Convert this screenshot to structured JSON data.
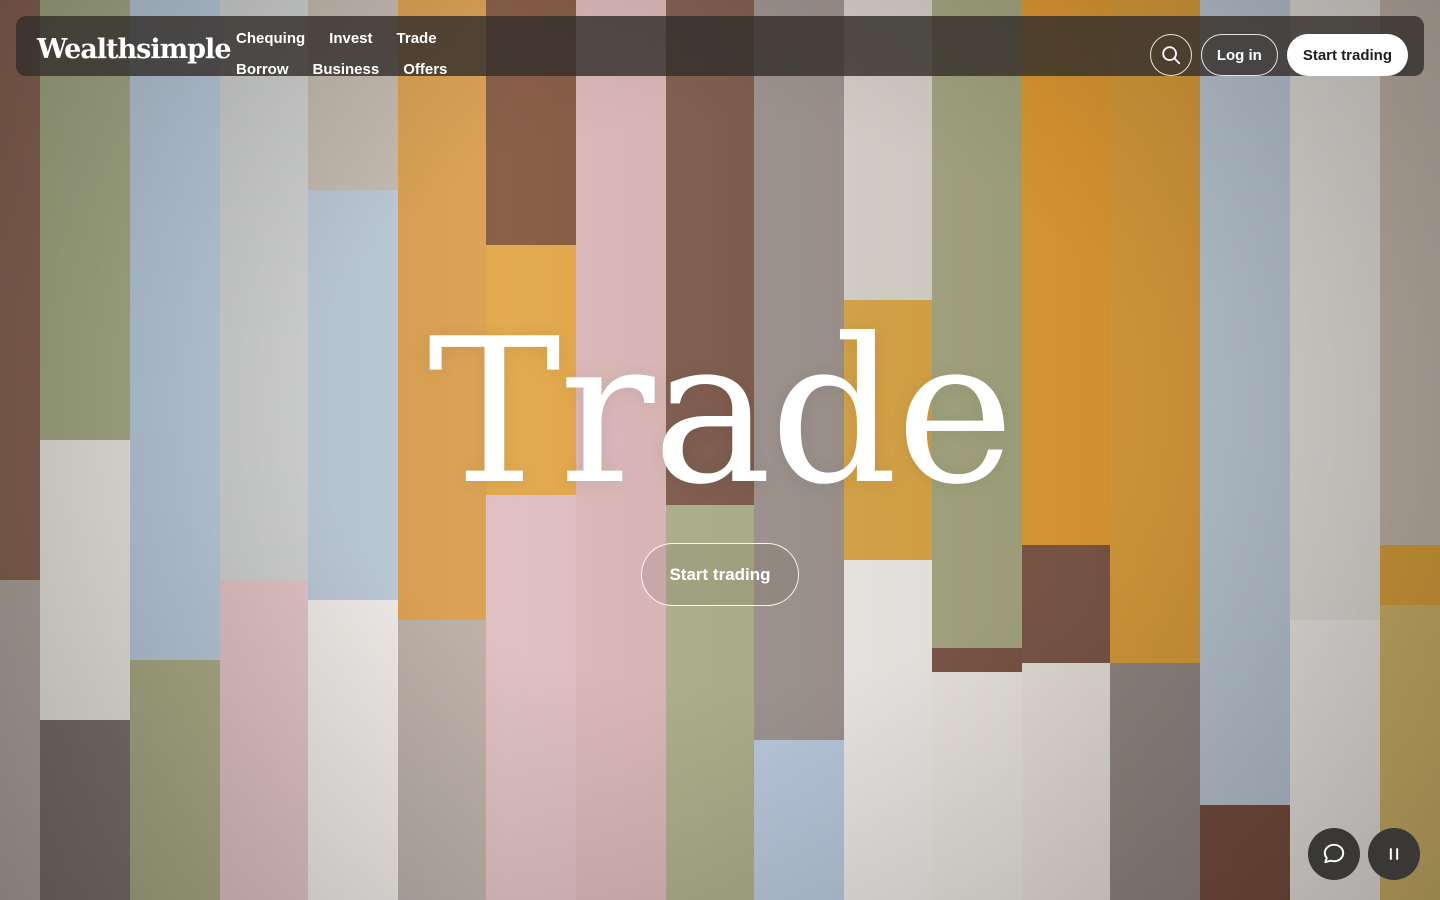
{
  "brand": {
    "logo_text": "Wealthsimple"
  },
  "nav": {
    "row1": [
      "Chequing",
      "Invest",
      "Trade"
    ],
    "row2": [
      "Borrow",
      "Business",
      "Offers"
    ],
    "login_label": "Log in",
    "start_trading_label": "Start trading",
    "search_icon": "search-icon"
  },
  "hero": {
    "title": "Trade",
    "cta_label": "Start trading"
  },
  "floating": {
    "chat_icon": "chat-bubble-icon",
    "pause_icon": "pause-icon"
  },
  "colors": {
    "nav_background": "#34302c",
    "primary_button_bg": "#ffffff",
    "primary_button_text": "#1f1f1f",
    "text_light": "#ffffff",
    "fab_background": "#3a3835"
  }
}
